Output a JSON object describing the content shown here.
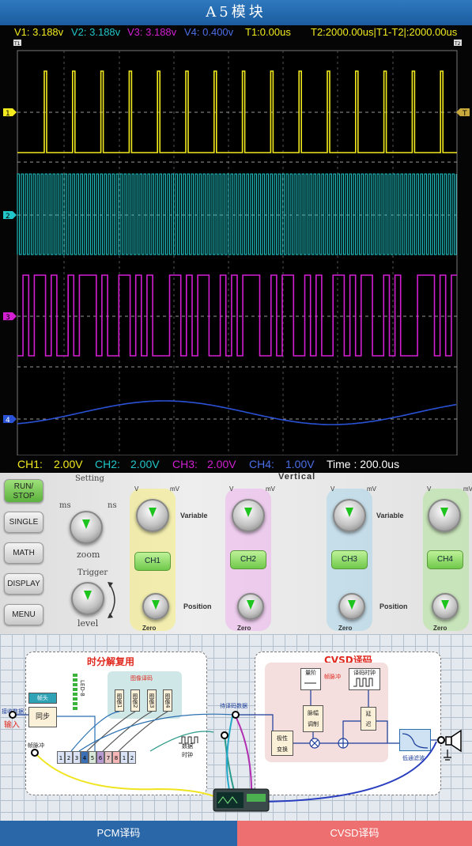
{
  "title": "A5模块",
  "readouts": {
    "v1": "V1: 3.188v",
    "v2": "V2: 3.188v",
    "v3": "V3: 3.188v",
    "v4": "V4: 0.400v",
    "t1": "T1:0.00us",
    "t2": "T2:2000.00us|T1-T2|:2000.00us"
  },
  "markers": {
    "t1": "T1",
    "t2": "T2",
    "ch1": "1",
    "ch2": "2",
    "ch3": "3",
    "ch4": "4",
    "trigger": "T"
  },
  "scales": {
    "ch1_label": "CH1:",
    "ch1_value": "2.00V",
    "ch2_label": "CH2:",
    "ch2_value": "2.00V",
    "ch3_label": "CH3:",
    "ch3_value": "2.00V",
    "ch4_label": "CH4:",
    "ch4_value": "1.00V",
    "time": "Time : 200.0us"
  },
  "colors": {
    "ch1": "#f2ea1e",
    "ch2": "#21c6c9",
    "ch3": "#d21fd2",
    "ch4": "#2a52d6",
    "ch4_text": "#4b6fe8"
  },
  "panel": {
    "run_stop": "RUN/\nSTOP",
    "single": "SINGLE",
    "math": "MATH",
    "display": "DISPLAY",
    "menu": "MENU",
    "setting": "Setting",
    "ms": "ms",
    "ns": "ns",
    "zoom": "zoom",
    "trigger": "Trigger",
    "level": "level",
    "vertical": "Vertical",
    "variable": "Variable",
    "position": "Position",
    "zero": "Zero",
    "v": "V",
    "mv": "mV",
    "channels": [
      "CH1",
      "CH2",
      "CH3",
      "CH4"
    ]
  },
  "diagram": {
    "tdm_title": "时分解复用",
    "cvsd_title": "CVSD译码",
    "recv_data": "接收数据",
    "input": "输入",
    "frame_pulse": "帧脉冲",
    "frame_head": "帧头",
    "sync": "同步",
    "led": "LED-8",
    "image_decode": "图像译码",
    "slots": [
      "图像1",
      "图像2",
      "图像3",
      "图像4"
    ],
    "cells": [
      "1",
      "2",
      "3",
      "4",
      "5",
      "6",
      "7",
      "8",
      "1",
      "2"
    ],
    "data_clock_1": "数据",
    "data_clock_2": "时钟",
    "pending_data": "待译码数据",
    "quantize": "量阶",
    "frame_pulse2": "帧脉冲",
    "decode_clock": "译码时钟",
    "pulse_mod": "脉幅\n调制",
    "delay": "延\n迟",
    "syllabic": "极性\n变换",
    "lowpass": "低通滤波"
  },
  "tabs": {
    "pcm": "PCM译码",
    "cvsd": "CVSD译码"
  }
}
